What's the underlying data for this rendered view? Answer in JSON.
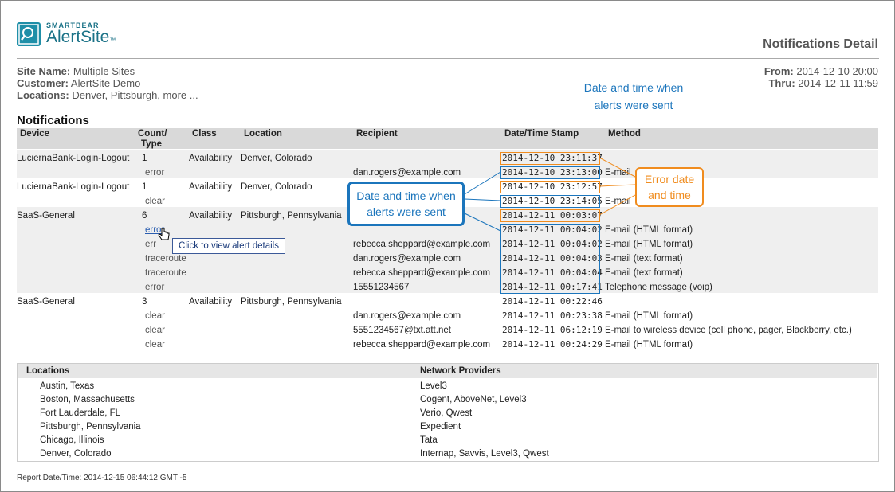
{
  "header": {
    "logo_brand": "SMARTBEAR",
    "logo_product": "AlertSite",
    "logo_tm": "™",
    "page_title": "Notifications Detail"
  },
  "meta": {
    "site_label": "Site Name:",
    "site_value": "Multiple Sites",
    "customer_label": "Customer:",
    "customer_value": "AlertSite Demo",
    "locations_label": "Locations:",
    "locations_value": "Denver, Pittsburgh, more ...",
    "from_label": "From:",
    "from_value": "2014-12-10 20:00",
    "thru_label": "Thru:",
    "thru_value": "2014-12-11 11:59"
  },
  "notifications": {
    "title": "Notifications",
    "columns": {
      "device": "Device",
      "count_1": "Count/",
      "count_2": "Type",
      "class": "Class",
      "location": "Location",
      "recipient": "Recipient",
      "timestamp": "Date/Time Stamp",
      "method": "Method"
    },
    "rows": [
      {
        "device": "LuciernaBank-Login-Logout",
        "count": "1",
        "class": "Availability",
        "location": "Denver, Colorado",
        "recipient": "",
        "timestamp": "2014-12-10 23:11:37",
        "method": ""
      },
      {
        "device": "",
        "count": "error",
        "class": "",
        "location": "",
        "recipient": "dan.rogers@example.com",
        "timestamp": "2014-12-10 23:13:00",
        "method": "E-mail"
      },
      {
        "device": "LuciernaBank-Login-Logout",
        "count": "1",
        "class": "Availability",
        "location": "Denver, Colorado",
        "recipient": "",
        "timestamp": "2014-12-10 23:12:57",
        "method": ""
      },
      {
        "device": "",
        "count": "clear",
        "class": "",
        "location": "",
        "recipient": "",
        "timestamp": "2014-12-10 23:14:05",
        "method": "E-mail"
      },
      {
        "device": "SaaS-General",
        "count": "6",
        "class": "Availability",
        "location": "Pittsburgh, Pennsylvania",
        "recipient": "",
        "timestamp": "2014-12-11 00:03:07",
        "method": ""
      },
      {
        "device": "",
        "count": "error",
        "class": "",
        "location": "",
        "recipient": "",
        "timestamp": "2014-12-11 00:04:02",
        "method": "E-mail (HTML format)"
      },
      {
        "device": "",
        "count": "err",
        "class": "",
        "location": "",
        "recipient": "rebecca.sheppard@example.com",
        "timestamp": "2014-12-11 00:04:02",
        "method": "E-mail (HTML format)"
      },
      {
        "device": "",
        "count": "traceroute",
        "class": "",
        "location": "",
        "recipient": "dan.rogers@example.com",
        "timestamp": "2014-12-11 00:04:03",
        "method": "E-mail (text format)"
      },
      {
        "device": "",
        "count": "traceroute",
        "class": "",
        "location": "",
        "recipient": "rebecca.sheppard@example.com",
        "timestamp": "2014-12-11 00:04:04",
        "method": "E-mail (text format)"
      },
      {
        "device": "",
        "count": "error",
        "class": "",
        "location": "",
        "recipient": "15551234567",
        "timestamp": "2014-12-11 00:17:41",
        "method": "Telephone message (voip)"
      },
      {
        "device": "SaaS-General",
        "count": "3",
        "class": "Availability",
        "location": "Pittsburgh, Pennsylvania",
        "recipient": "",
        "timestamp": "2014-12-11 00:22:46",
        "method": ""
      },
      {
        "device": "",
        "count": "clear",
        "class": "",
        "location": "",
        "recipient": "dan.rogers@example.com",
        "timestamp": "2014-12-11 00:23:38",
        "method": "E-mail (HTML format)"
      },
      {
        "device": "",
        "count": "clear",
        "class": "",
        "location": "",
        "recipient": "5551234567@txt.att.net",
        "timestamp": "2014-12-11 06:12:19",
        "method": "E-mail to wireless device (cell phone, pager, Blackberry, etc.)"
      },
      {
        "device": "",
        "count": "clear",
        "class": "",
        "location": "",
        "recipient": "rebecca.sheppard@example.com",
        "timestamp": "2014-12-11 00:24:29",
        "method": "E-mail (HTML format)"
      }
    ],
    "hidden_recipient_row1": "dan.rogers@example.com"
  },
  "annotations": {
    "top_callout_line1": "Date and time when",
    "top_callout_line2": "alerts were sent",
    "blue_callout_line1": "Date and time when",
    "blue_callout_line2": "alerts were sent",
    "orange_callout_line1": "Error date",
    "orange_callout_line2": "and time",
    "tooltip": "Click to view alert details",
    "accent_blue": "#1b75bc",
    "accent_orange": "#f08c1e"
  },
  "locations_table": {
    "col1_header": "Locations",
    "col2_header": "Network Providers",
    "rows": [
      {
        "location": "Austin, Texas",
        "providers": "Level3"
      },
      {
        "location": "Boston, Massachusetts",
        "providers": "Cogent, AboveNet, Level3"
      },
      {
        "location": "Fort Lauderdale, FL",
        "providers": "Verio, Qwest"
      },
      {
        "location": "Pittsburgh, Pennsylvania",
        "providers": "Expedient"
      },
      {
        "location": "Chicago, Illinois",
        "providers": "Tata"
      },
      {
        "location": "Denver, Colorado",
        "providers": "Internap, Savvis, Level3, Qwest"
      }
    ]
  },
  "footer": {
    "report_label": "Report Date/Time:",
    "report_value": "2014-12-15 06:44:12 GMT -5"
  }
}
